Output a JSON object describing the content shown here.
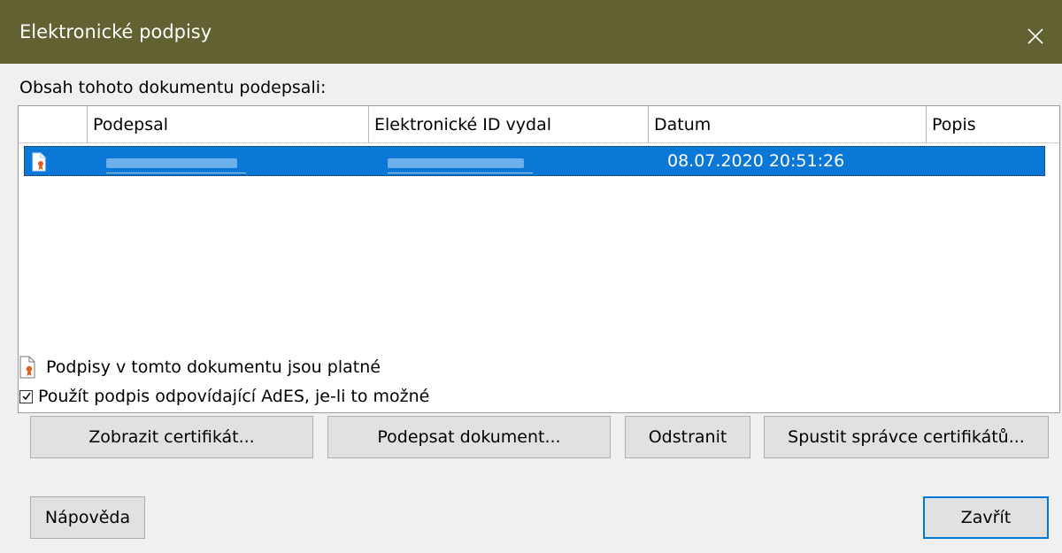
{
  "window": {
    "title": "Elektronické podpisy",
    "close_glyph": "✕"
  },
  "list": {
    "label": "Obsah tohoto dokumentu podepsali:",
    "columns": [
      "",
      "Podepsal",
      "Elektronické ID vydal",
      "Datum",
      "Popis"
    ],
    "rows": [
      {
        "icon": "signed-document-icon",
        "signed_by": "",
        "issued_by": "",
        "date": "08.07.2020 20:51:26",
        "description": ""
      }
    ]
  },
  "status": {
    "icon": "signed-document-icon",
    "text": "Podpisy v tomto dokumentu jsou platné"
  },
  "ades_checkbox": {
    "checked": true,
    "label": "Použít podpis odpovídající AdES, je-li to možné"
  },
  "buttons": {
    "view_certificate": "Zobrazit certifikát...",
    "sign_document": "Podepsat dokument...",
    "remove": "Odstranit",
    "start_cert_manager": "Spustit správce certifikátů...",
    "help": "Nápověda",
    "close": "Zavřít"
  },
  "colors": {
    "titlebar": "#626132",
    "selection": "#0b78d7",
    "default_button_border": "#0078d7"
  }
}
